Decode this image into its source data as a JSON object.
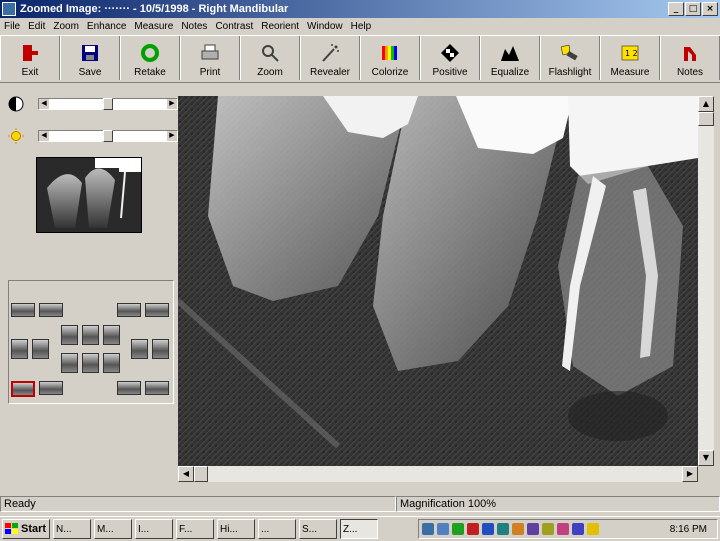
{
  "window": {
    "title": "Zoomed Image: ·······  - 10/5/1998 - Right Mandibular"
  },
  "menu": [
    "File",
    "Edit",
    "Zoom",
    "Enhance",
    "Measure",
    "Notes",
    "Contrast",
    "Reorient",
    "Window",
    "Help"
  ],
  "toolbar": [
    {
      "label": "Exit",
      "icon": "exit-door-icon",
      "color": "#c00000"
    },
    {
      "label": "Save",
      "icon": "floppy-disk-icon",
      "color": "#000080"
    },
    {
      "label": "Retake",
      "icon": "retake-arrow-icon",
      "color": "#00a000"
    },
    {
      "label": "Print",
      "icon": "printer-icon",
      "color": "#404040"
    },
    {
      "label": "Zoom",
      "icon": "magnifier-icon",
      "color": "#404040"
    },
    {
      "label": "Revealer",
      "icon": "wand-icon",
      "color": "#404040"
    },
    {
      "label": "Colorize",
      "icon": "color-bars-icon",
      "color": "#ff0000"
    },
    {
      "label": "Positive",
      "icon": "positive-icon",
      "color": "#000000"
    },
    {
      "label": "Equalize",
      "icon": "histogram-icon",
      "color": "#000000"
    },
    {
      "label": "Flashlight",
      "icon": "flashlight-icon",
      "color": "#e0c000"
    },
    {
      "label": "Measure",
      "icon": "ruler-icon",
      "color": "#e0c000"
    },
    {
      "label": "Notes",
      "icon": "notes-icon",
      "color": "#c00000"
    }
  ],
  "sliders": {
    "contrast": 0.5,
    "brightness": 0.5
  },
  "status": {
    "left": "Ready",
    "right": "Magnification 100%"
  },
  "taskbar": {
    "start": "Start",
    "tasks": [
      "N...",
      "M...",
      "I...",
      "F...",
      "Hi...",
      "...",
      "S...",
      "Z..."
    ],
    "clock": "8:16 PM"
  },
  "colors": {
    "title_start": "#0a246a",
    "title_end": "#a6caf0",
    "face": "#d4d0c8"
  }
}
